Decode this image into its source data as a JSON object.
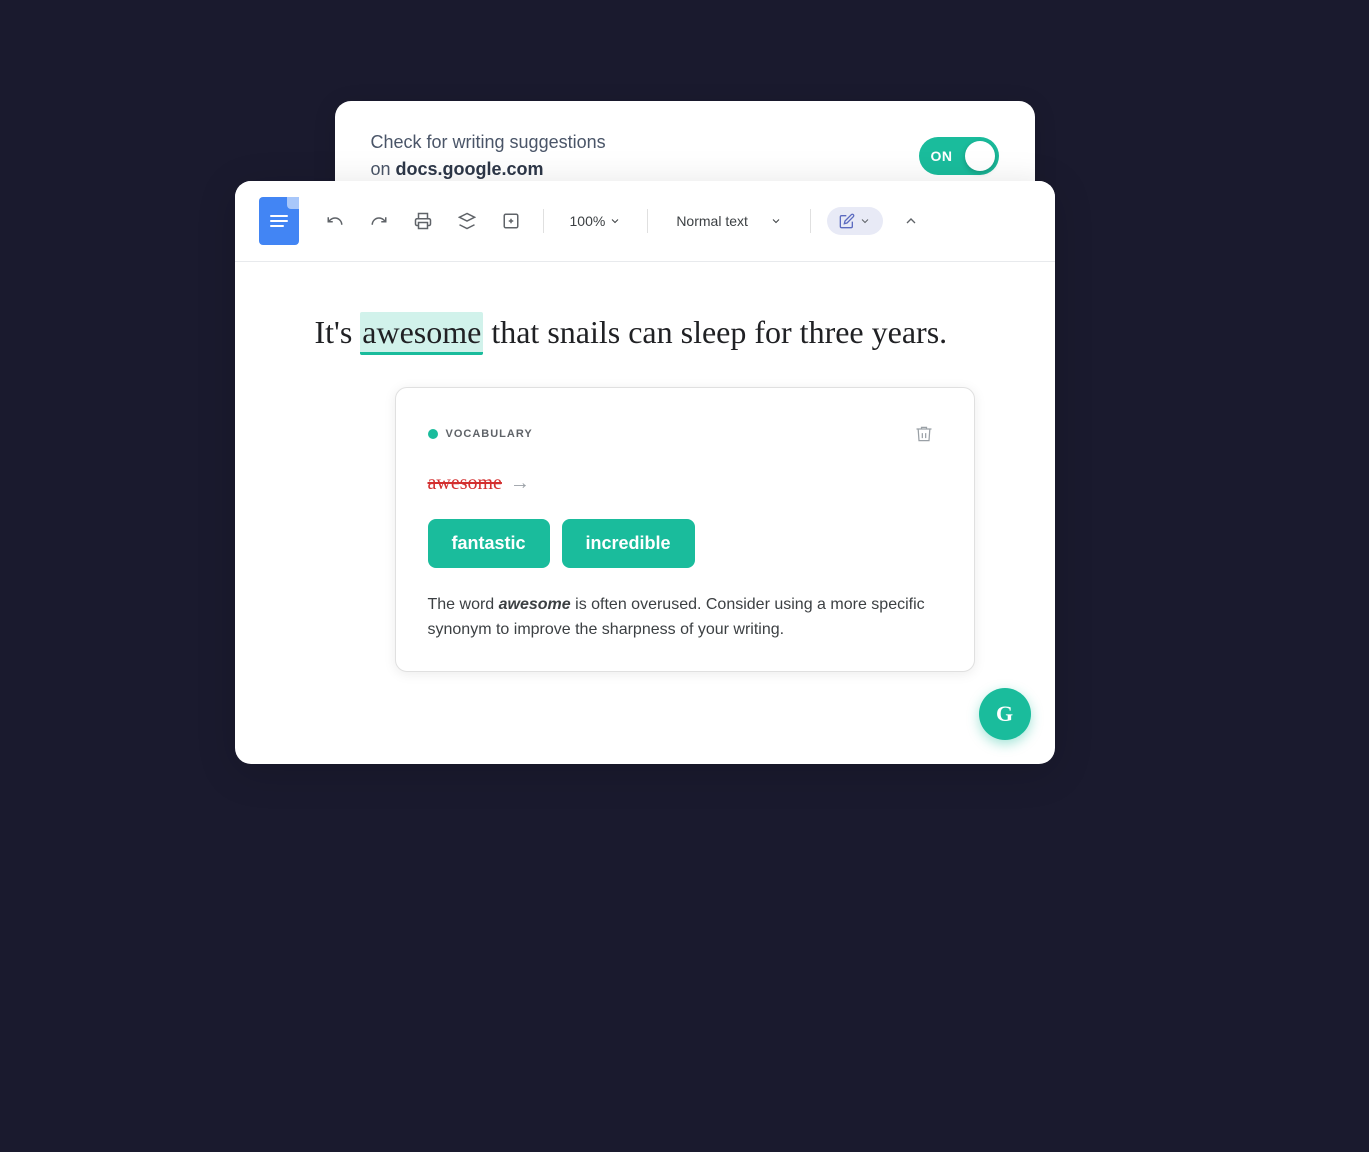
{
  "top_card": {
    "text_line1": "Check for writing suggestions",
    "text_line2": "on ",
    "domain": "docs.google.com",
    "toggle_label": "ON"
  },
  "toolbar": {
    "zoom": "100%",
    "style": "Normal text",
    "undo_label": "Undo",
    "redo_label": "Redo",
    "print_label": "Print",
    "paint_format_label": "Paint format",
    "insert_label": "Insert",
    "edit_label": "Editing",
    "collapse_label": "Collapse"
  },
  "document": {
    "sentence_before": "It's ",
    "highlighted_word": "awesome",
    "sentence_after": " that snails can sleep for three years."
  },
  "suggestion": {
    "category_label": "VOCABULARY",
    "original_word": "awesome",
    "arrow": "→",
    "button1": "fantastic",
    "button2": "incredible",
    "description_before": "The word ",
    "description_word": "awesome",
    "description_after": " is often overused. Consider using a more specific synonym to improve the sharpness of your writing."
  },
  "fab": {
    "label": "G"
  }
}
